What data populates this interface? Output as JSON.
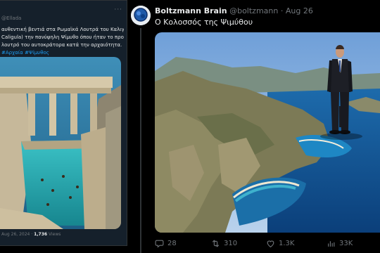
{
  "left_tweet": {
    "handle": "@Ellada",
    "more": "···",
    "lines": [
      "αυθεντική βεντιά στα Ρωμαϊκά Λουτρά του Καλιγούλα (Terme di",
      "Caligula) την πανύψηλη Ψίμυθο όπου ήταν το προσωπικό",
      "λουτρό του αυτοκράτορα κατά την αρχαιότητα."
    ],
    "hashtag": "#Αρχαία #Ψίμυθος",
    "date": "Aug 26, 2024",
    "views_count": "1,736",
    "views_label": "Views"
  },
  "right_tweet": {
    "name": "Boltzmann Brain",
    "handle": "@boltzmann",
    "separator": "·",
    "date": "Aug 26",
    "text": "Ο Κολοσσός της Ψιμύθου",
    "actions": {
      "replies": "28",
      "retweets": "310",
      "likes": "1.3K",
      "views": "33K"
    }
  },
  "icons": [
    "reply-icon",
    "retweet-icon",
    "like-icon",
    "views-icon",
    "more-icon",
    "avatar-icon"
  ],
  "colors": {
    "background": "#000000",
    "card": "#15202b",
    "muted": "#71767b",
    "accent": "#1d9bf0",
    "text": "#e7e9ea"
  }
}
